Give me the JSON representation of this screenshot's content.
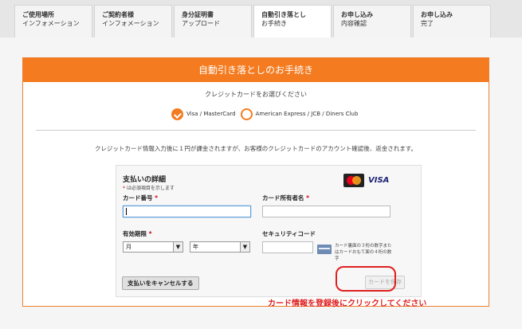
{
  "steps": [
    {
      "line1": "ご使用場所",
      "line2": "インフォメーション",
      "active": false
    },
    {
      "line1": "ご契約者様",
      "line2": "インフォメーション",
      "active": false
    },
    {
      "line1": "身分証明書",
      "line2": "アップロード",
      "active": false
    },
    {
      "line1": "自動引き落とし",
      "line2": "お手続き",
      "active": true
    },
    {
      "line1": "お申し込み",
      "line2": "内容確認",
      "active": false
    },
    {
      "line1": "お申し込み",
      "line2": "完了",
      "active": false
    }
  ],
  "card": {
    "header": "自動引き落としのお手続き",
    "select_label": "クレジットカードをお選びください",
    "brand_option_1": "Visa / MasterCard",
    "brand_option_2": "American Express / JCB / Diners Club",
    "notice": "クレジットカード情報入力後に１円が課金されますが、お客様のクレジットカードのアカウント確認後、返金されます。"
  },
  "payment": {
    "title": "支払いの詳細",
    "required_note": "は必須項目を示します",
    "required_mark": "*",
    "logo_visa": "VISA",
    "card_number_label": "カード番号",
    "card_holder_label": "カード所有者名",
    "expiry_label": "有効期限",
    "month_value": "月",
    "year_value": "年",
    "security_code_label": "セキュリティコード",
    "cvv_hint": "カード裏面の３桁の数字またはカードおもて面の４桁の数字",
    "cancel_button": "支払いをキャンセルする",
    "save_button": "カードを保存"
  },
  "annotation": "カード情報を登録後にクリックしてください",
  "colors": {
    "accent": "#f47b20",
    "annotation": "#e02020"
  }
}
